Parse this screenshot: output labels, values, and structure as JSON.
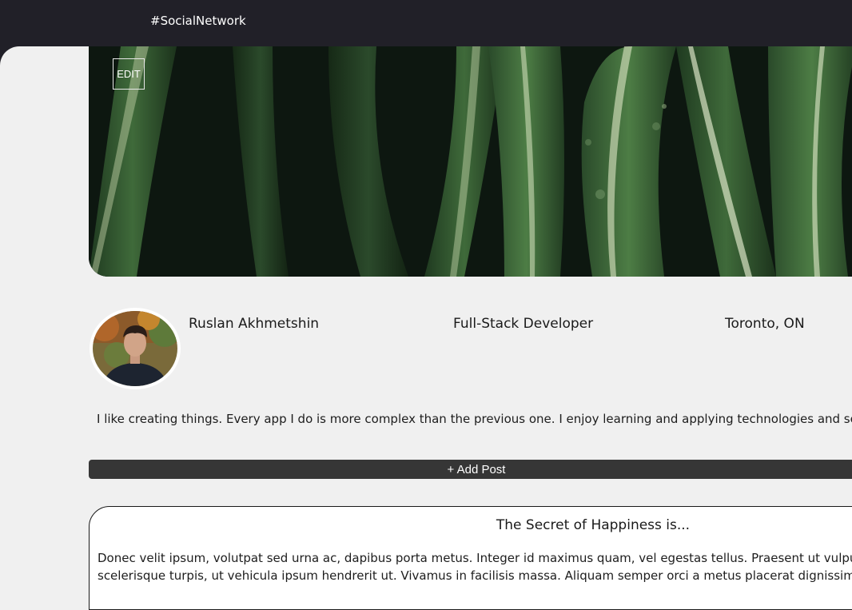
{
  "header": {
    "brand": "#SocialNetwork"
  },
  "cover": {
    "edit_label": "EDIT"
  },
  "profile": {
    "name": "Ruslan Akhmetshin",
    "title": "Full-Stack Developer",
    "location": "Toronto, ON",
    "bio": "I like creating things. Every app I do is more complex than the previous one. I enjoy learning and applying technologies and seeing"
  },
  "actions": {
    "add_post_label": "+ Add Post"
  },
  "posts": [
    {
      "title": "The Secret of Happiness is...",
      "body_line1": "Donec velit ipsum, volutpat sed urna ac, dapibus porta metus. Integer id maximus quam, vel egestas tellus. Praesent ut vulputate li",
      "body_line2": "scelerisque turpis, ut vehicula ipsum hendrerit ut. Vivamus in facilisis massa. Aliquam semper orci a metus placerat dignissim. Aliqu"
    }
  ],
  "colors": {
    "topbar": "#212028",
    "page_bg": "#f0f0f0",
    "button_bg": "#363636"
  }
}
